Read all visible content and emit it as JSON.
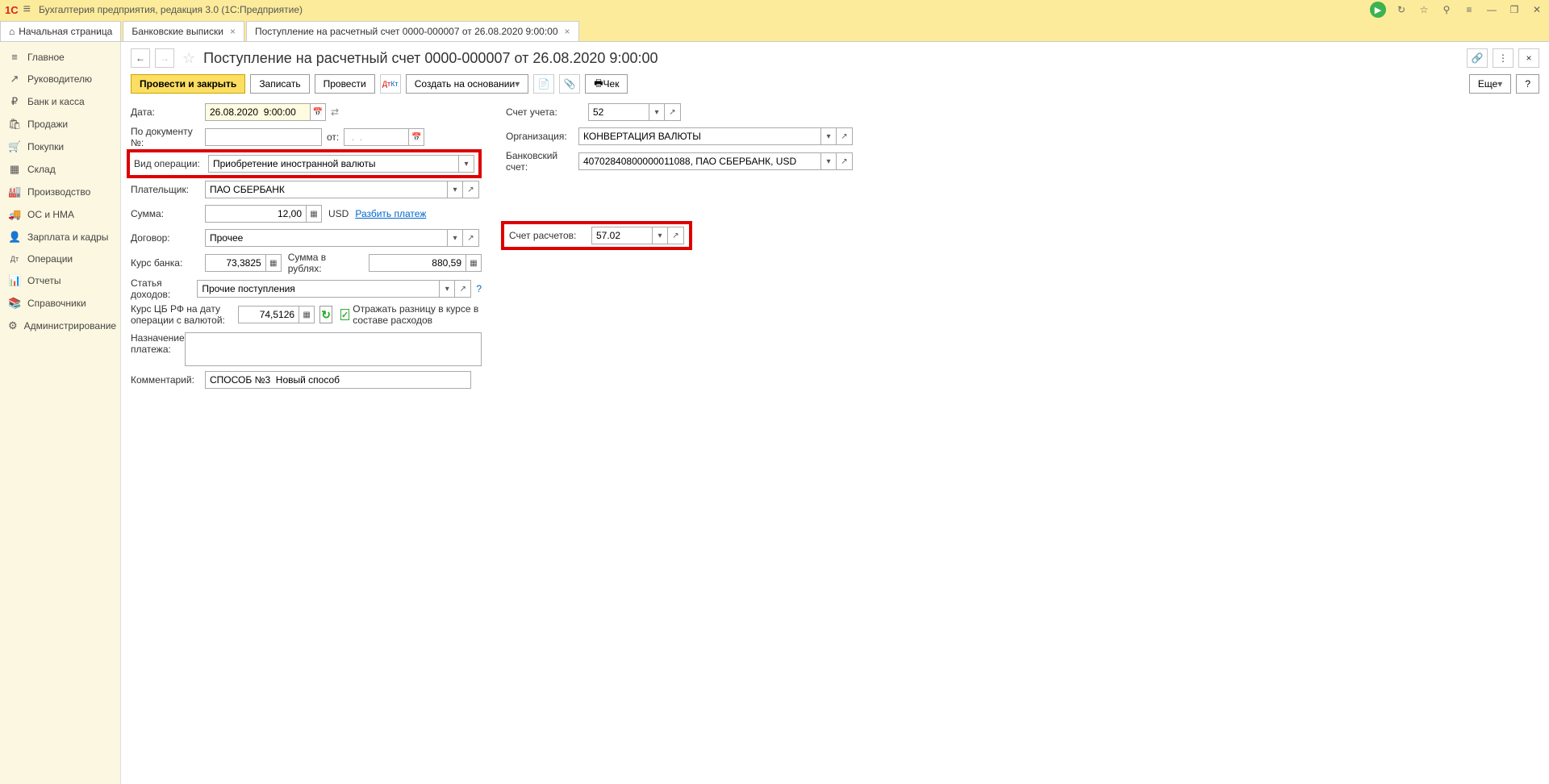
{
  "titlebar": {
    "logo": "1С",
    "title": "Бухгалтерия предприятия, редакция 3.0  (1С:Предприятие)"
  },
  "tabs": {
    "home": "Начальная страница",
    "tab1": "Банковские выписки",
    "tab2": "Поступление на расчетный счет 0000-000007 от 26.08.2020 9:00:00"
  },
  "sidebar": [
    {
      "label": "Главное",
      "icon": "≡"
    },
    {
      "label": "Руководителю",
      "icon": "↗"
    },
    {
      "label": "Банк и касса",
      "icon": "₽"
    },
    {
      "label": "Продажи",
      "icon": "🛍"
    },
    {
      "label": "Покупки",
      "icon": "🛒"
    },
    {
      "label": "Склад",
      "icon": "▦"
    },
    {
      "label": "Производство",
      "icon": "🏭"
    },
    {
      "label": "ОС и НМА",
      "icon": "🚚"
    },
    {
      "label": "Зарплата и кадры",
      "icon": "👤"
    },
    {
      "label": "Операции",
      "icon": "Дт"
    },
    {
      "label": "Отчеты",
      "icon": "📊"
    },
    {
      "label": "Справочники",
      "icon": "📚"
    },
    {
      "label": "Администрирование",
      "icon": "⚙"
    }
  ],
  "page": {
    "title": "Поступление на расчетный счет 0000-000007 от 26.08.2020 9:00:00"
  },
  "toolbar": {
    "post_close": "Провести и закрыть",
    "save": "Записать",
    "post": "Провести",
    "create_based": "Создать на основании",
    "check": "Чек",
    "more": "Еще",
    "help": "?"
  },
  "labels": {
    "date": "Дата:",
    "doc_no": "По документу №:",
    "from": "от:",
    "op_type": "Вид операции:",
    "payer": "Плательщик:",
    "sum": "Сумма:",
    "contract": "Договор:",
    "bank_rate": "Курс банка:",
    "sum_rub_lbl": "Сумма в рублях:",
    "income_item": "Статья доходов:",
    "cbr_rate": "Курс ЦБ РФ на дату операции с валютой:",
    "reflect_diff": "Отражать разницу в курсе в составе расходов",
    "payment_purpose": "Назначение платежа:",
    "comment": "Комментарий:",
    "account": "Счет учета:",
    "organization": "Организация:",
    "bank_account": "Банковский счет:",
    "settle_account": "Счет расчетов:",
    "split_payment": "Разбить платеж",
    "currency": "USD"
  },
  "values": {
    "date": "26.08.2020  9:00:00",
    "doc_no": "",
    "from": " .  .    ",
    "op_type": "Приобретение иностранной валюты",
    "payer": "ПАО СБЕРБАНК",
    "sum": "12,00",
    "contract": "Прочее",
    "bank_rate": "73,3825",
    "sum_rub": "880,59",
    "income_item": "Прочие поступления",
    "cbr_rate": "74,5126",
    "comment": "СПОСОБ №3  Новый способ",
    "account": "52",
    "organization": "КОНВЕРТАЦИЯ ВАЛЮТЫ",
    "bank_account": "40702840800000011088, ПАО СБЕРБАНК, USD",
    "settle_account": "57.02",
    "payment_purpose": ""
  }
}
